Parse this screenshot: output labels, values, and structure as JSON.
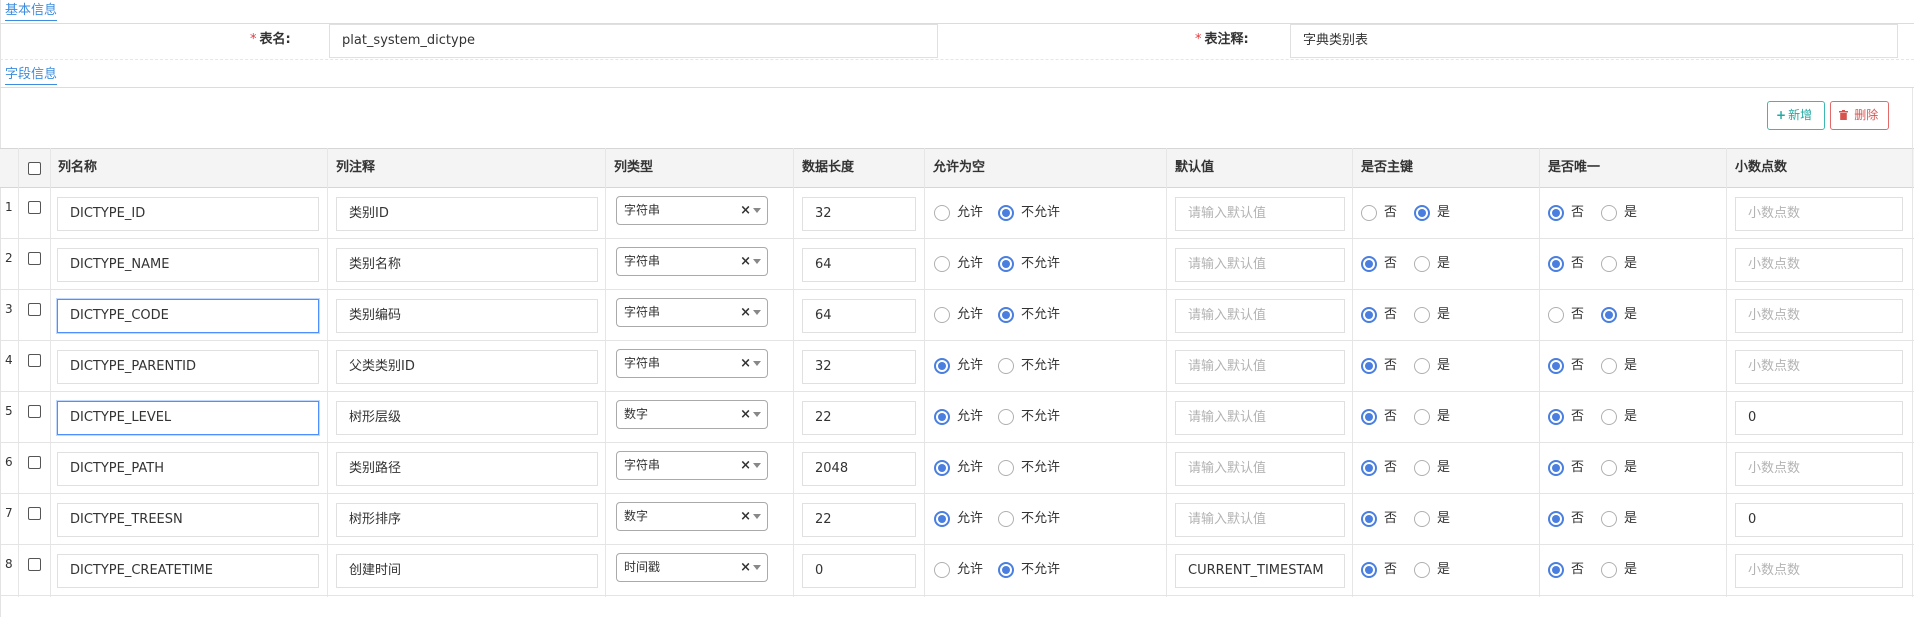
{
  "sections": {
    "basic_title": "基本信息",
    "field_title": "字段信息"
  },
  "basic": {
    "table_name_label": "表名:",
    "table_name_value": "plat_system_dictype",
    "table_comment_label": "表注释:",
    "table_comment_value": "字典类别表",
    "required_mark": "*"
  },
  "toolbar": {
    "add_label": "新增",
    "add_icon": "+",
    "delete_label": "删除",
    "delete_icon": "trash-icon"
  },
  "columns": [
    "列名称",
    "列注释",
    "列类型",
    "数据长度",
    "允许为空",
    "默认值",
    "是否主键",
    "是否唯一",
    "小数点数"
  ],
  "options": {
    "allow": "允许",
    "disallow": "不允许",
    "no": "否",
    "yes": "是",
    "clear_glyph": "×"
  },
  "placeholders": {
    "default": "请输入默认值",
    "decimal": "小数点数"
  },
  "rows": [
    {
      "num": "1",
      "name": "DICTYPE_ID",
      "comment": "类别ID",
      "type": "字符串",
      "length": "32",
      "nullable": false,
      "default": "",
      "pk": true,
      "unique": false,
      "decimal": ""
    },
    {
      "num": "2",
      "name": "DICTYPE_NAME",
      "comment": "类别名称",
      "type": "字符串",
      "length": "64",
      "nullable": false,
      "default": "",
      "pk": false,
      "unique": false,
      "decimal": ""
    },
    {
      "num": "3",
      "name": "DICTYPE_CODE",
      "comment": "类别编码",
      "type": "字符串",
      "length": "64",
      "nullable": false,
      "default": "",
      "pk": false,
      "unique": true,
      "decimal": ""
    },
    {
      "num": "4",
      "name": "DICTYPE_PARENTID",
      "comment": "父类类别ID",
      "type": "字符串",
      "length": "32",
      "nullable": true,
      "default": "",
      "pk": false,
      "unique": false,
      "decimal": ""
    },
    {
      "num": "5",
      "name": "DICTYPE_LEVEL",
      "comment": "树形层级",
      "type": "数字",
      "length": "22",
      "nullable": true,
      "default": "",
      "pk": false,
      "unique": false,
      "decimal": "0"
    },
    {
      "num": "6",
      "name": "DICTYPE_PATH",
      "comment": "类别路径",
      "type": "字符串",
      "length": "2048",
      "nullable": true,
      "default": "",
      "pk": false,
      "unique": false,
      "decimal": ""
    },
    {
      "num": "7",
      "name": "DICTYPE_TREESN",
      "comment": "树形排序",
      "type": "数字",
      "length": "22",
      "nullable": true,
      "default": "",
      "pk": false,
      "unique": false,
      "decimal": "0"
    },
    {
      "num": "8",
      "name": "DICTYPE_CREATETIME",
      "comment": "创建时间",
      "type": "时间戳",
      "length": "0",
      "nullable": false,
      "default": "CURRENT_TIMESTAM",
      "pk": false,
      "unique": false,
      "decimal": ""
    }
  ],
  "colors": {
    "accent": "#3c8dde",
    "radio_on": "#4a7fe0",
    "add_button": "#20a8a2",
    "delete_button": "#d9534f",
    "required": "#e4393c"
  }
}
